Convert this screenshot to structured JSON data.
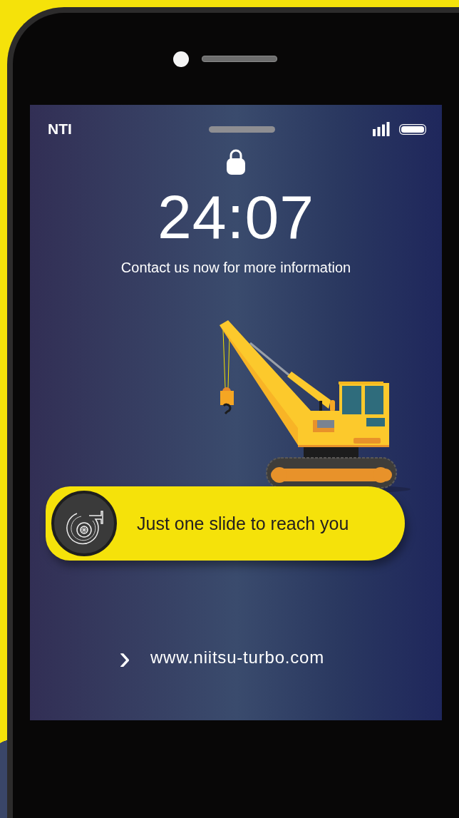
{
  "status_bar": {
    "carrier": "NTI"
  },
  "lock_screen": {
    "time": "24:07",
    "message": "Contact us now for more information"
  },
  "slider": {
    "label": "Just one slide to reach you"
  },
  "link": {
    "chevron": "›",
    "url": "www.niitsu-turbo.com"
  }
}
